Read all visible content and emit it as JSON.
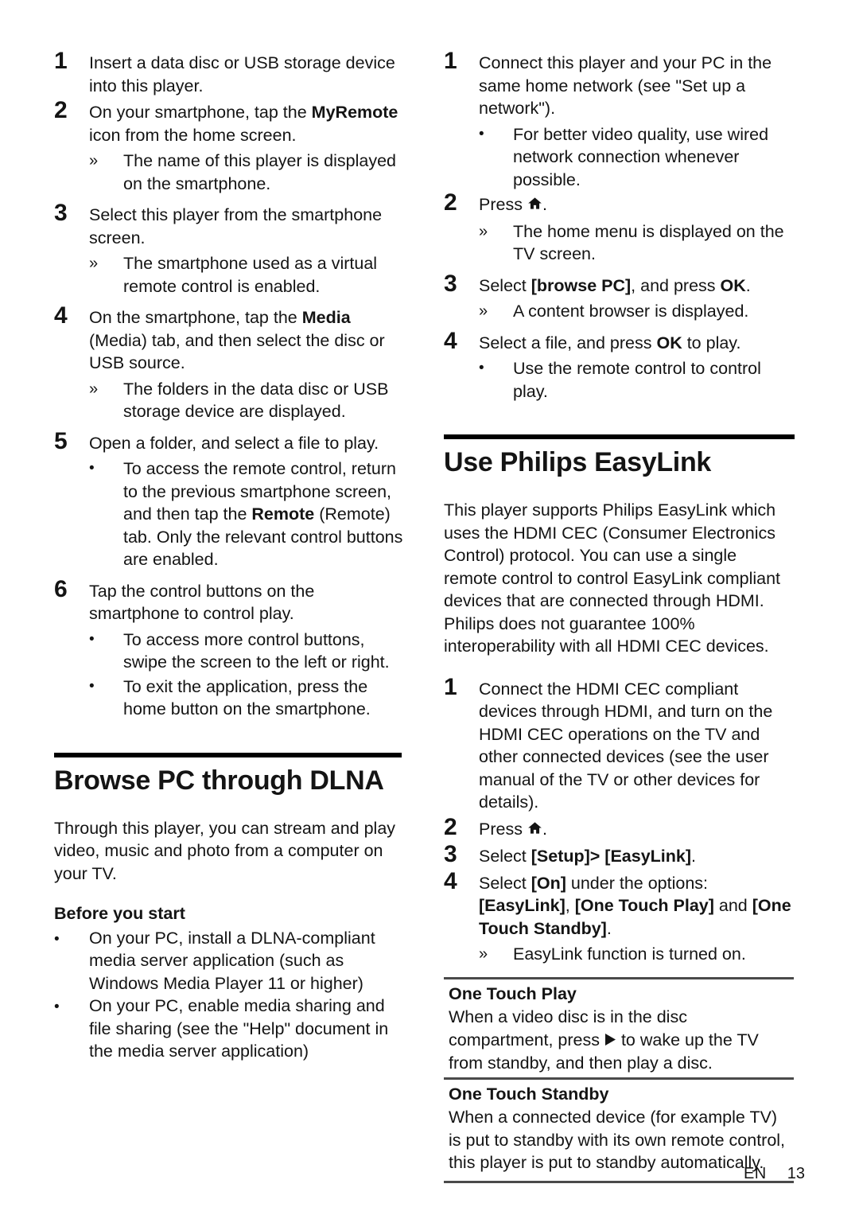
{
  "document": {
    "footer": {
      "language": "EN",
      "page_number": "13"
    }
  },
  "left_column": {
    "myremote_steps": [
      {
        "num": "1",
        "text": "Insert a data disc or USB storage device into this player."
      },
      {
        "num": "2",
        "text_prefix": "On your smartphone, tap the ",
        "bold": "MyRemote",
        "text_suffix": " icon from the home screen.",
        "subs": [
          {
            "mark": "»",
            "text": "The name of this player is displayed on the smartphone."
          }
        ]
      },
      {
        "num": "3",
        "text": "Select this player from the smartphone screen.",
        "subs": [
          {
            "mark": "»",
            "text": "The smartphone used as a virtual remote control is enabled."
          }
        ]
      },
      {
        "num": "4",
        "text_prefix": "On the smartphone, tap the ",
        "bold": "Media",
        "text_suffix": " (Media) tab, and then select the disc or USB source.",
        "subs": [
          {
            "mark": "»",
            "text": "The folders in the data disc or USB storage device are displayed."
          }
        ]
      },
      {
        "num": "5",
        "text": "Open a folder, and select a file to play.",
        "subs": [
          {
            "mark": "•",
            "text_prefix": "To access the remote control, return to the previous smartphone screen, and then tap the ",
            "bold": "Remote",
            "text_suffix": " (Remote) tab. Only the relevant control buttons are enabled."
          }
        ]
      },
      {
        "num": "6",
        "text": "Tap the control buttons on the smartphone to control play.",
        "subs": [
          {
            "mark": "•",
            "text": "To access more control buttons, swipe the screen to the left or right."
          },
          {
            "mark": "•",
            "text": "To exit the application, press the home button on the smartphone."
          }
        ]
      }
    ],
    "dlna_section": {
      "title": "Browse PC through DLNA",
      "intro": "Through this player, you can stream and play video, music and photo from a computer on your TV.",
      "before_heading": "Before you start",
      "before_items": [
        {
          "mark": "•",
          "text": "On your PC, install a DLNA-compliant media server application (such as Windows Media Player 11 or higher)"
        },
        {
          "mark": "•",
          "text": "On your PC, enable media sharing and file sharing (see the \"Help\" document in the media server application)"
        }
      ]
    }
  },
  "right_column": {
    "dlna_steps": [
      {
        "num": "1",
        "text": "Connect this player and your PC in the same home network (see \"Set up a network\").",
        "subs": [
          {
            "mark": "•",
            "text": "For better video quality, use wired network connection whenever possible."
          }
        ]
      },
      {
        "num": "2",
        "text_prefix": "Press ",
        "icon": "home-icon",
        "text_suffix": ".",
        "subs": [
          {
            "mark": "»",
            "text": "The home menu is displayed on the TV screen."
          }
        ]
      },
      {
        "num": "3",
        "text_prefix": "Select ",
        "bold": "[browse PC]",
        "text_mid": ", and press ",
        "bold2": "OK",
        "text_suffix": ".",
        "subs": [
          {
            "mark": "»",
            "text": "A content browser is displayed."
          }
        ]
      },
      {
        "num": "4",
        "text_prefix": "Select a file, and press ",
        "bold": "OK",
        "text_suffix": " to play.",
        "subs": [
          {
            "mark": "•",
            "text": "Use the remote control to control play."
          }
        ]
      }
    ],
    "easylink_section": {
      "title": "Use Philips EasyLink",
      "intro": "This player supports Philips EasyLink which uses the HDMI CEC (Consumer Electronics Control) protocol. You can use a single remote control to control EasyLink compliant devices that are connected through HDMI. Philips does not guarantee 100% interoperability with all HDMI CEC devices.",
      "steps": [
        {
          "num": "1",
          "text": "Connect the HDMI CEC compliant devices through HDMI, and turn on the HDMI CEC operations on the TV and other connected devices (see the user manual of the TV or other devices for details)."
        },
        {
          "num": "2",
          "text_prefix": "Press ",
          "icon": "home-icon",
          "text_suffix": "."
        },
        {
          "num": "3",
          "text_prefix": "Select ",
          "bold": "[Setup]> [EasyLink]",
          "text_suffix": "."
        },
        {
          "num": "4",
          "text_prefix": "Select ",
          "bold": "[On]",
          "text_mid": " under the options: ",
          "bold2": "[EasyLink]",
          "text_mid2": ", ",
          "bold3": "[One Touch Play]",
          "text_mid3": " and ",
          "bold4": "[One Touch Standby]",
          "text_suffix": ".",
          "subs": [
            {
              "mark": "»",
              "text": "EasyLink function is turned on."
            }
          ]
        }
      ],
      "notes": [
        {
          "title": "One Touch Play",
          "body_prefix": "When a video disc is in the disc compartment, press ",
          "icon": "play-icon",
          "body_suffix": " to wake up the TV from standby, and then play a disc."
        },
        {
          "title": "One Touch Standby",
          "body": "When a connected device (for example TV) is put to standby with its own remote control, this player is put to standby automatically."
        }
      ]
    }
  }
}
